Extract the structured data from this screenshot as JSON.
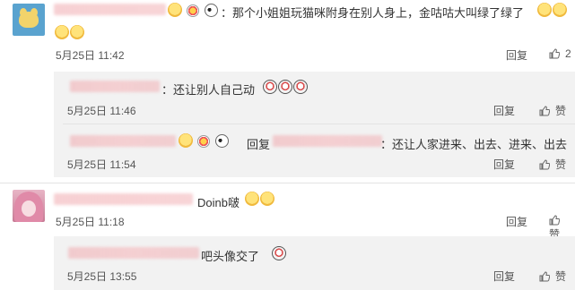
{
  "comments": [
    {
      "text": "：那个小姐姐玩猫咪附身在别人身上，金咕咕大叫绿了绿了",
      "time": "5月25日 11:42",
      "reply": "回复",
      "like": "2",
      "replies": [
        {
          "text": "：还让别人自己动",
          "time": "5月25日 11:46",
          "reply": "回复",
          "like": "赞"
        },
        {
          "prefix": "回复",
          "text": "：还让人家进来、出去、进来、出去",
          "time": "5月25日 11:54",
          "reply": "回复",
          "like": "赞"
        }
      ]
    },
    {
      "text": "Doinb啵",
      "time": "5月25日 11:18",
      "reply": "回复",
      "like": "赞",
      "replies": [
        {
          "text": "吧头像交了",
          "time": "5月25日 13:55",
          "reply": "回复",
          "like": "赞"
        }
      ]
    }
  ]
}
